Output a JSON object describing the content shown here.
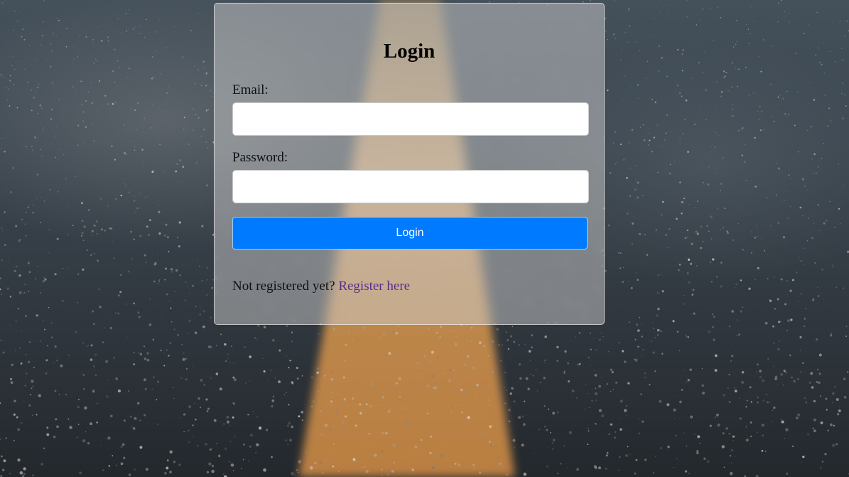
{
  "page": {
    "background": "asphalt-road-photo"
  },
  "login_card": {
    "title": "Login",
    "email": {
      "label": "Email:",
      "value": "",
      "placeholder": ""
    },
    "password": {
      "label": "Password:",
      "value": "",
      "placeholder": ""
    },
    "submit_label": "Login",
    "register_prompt": "Not registered yet?",
    "register_link": "Register here"
  },
  "colors": {
    "button": "#007bff",
    "button_text": "#ffffff",
    "link": "#5b2c8f"
  }
}
